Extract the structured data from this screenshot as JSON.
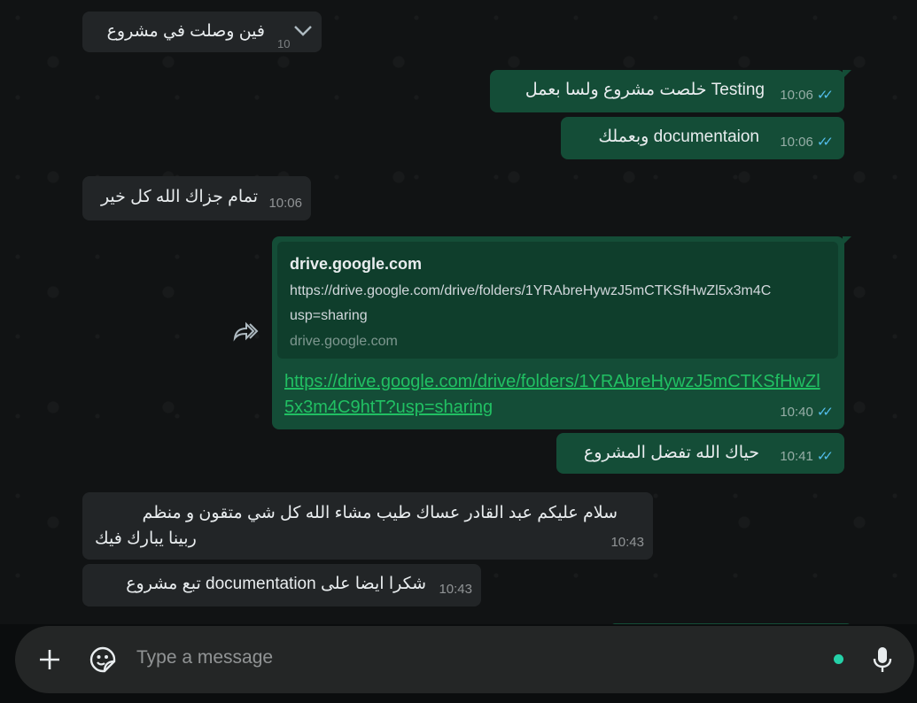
{
  "messages": {
    "m0": {
      "text": "فين وصلت في مشروع",
      "time": "10"
    },
    "m1": {
      "text": "Testing خلصت مشروع ولسا بعمل",
      "time": "10:06"
    },
    "m2": {
      "text": "documentaion وبعملك",
      "time": "10:06"
    },
    "m3": {
      "text": "تمام جزاك الله كل خير",
      "time": "10:06"
    },
    "m4": {
      "card_title": "drive.google.com",
      "card_desc": "https://drive.google.com/drive/folders/1YRAbreHywzJ5mCTKSfHwZl5x3m4C\nusp=sharing",
      "card_domain": "drive.google.com",
      "link": "https://drive.google.com/drive/folders/1YRAbreHywzJ5mCTKSfHwZl5x3m4C9htT?usp=sharing",
      "time": "10:40"
    },
    "m5": {
      "text": "حياك الله تفضل المشروع",
      "time": "10:41"
    },
    "m6": {
      "line1": "سلام عليكم عبد القادر عساك طيب  مشاء الله  كل شي متقون و منظم",
      "line2": "ربينا يبارك فيك",
      "time": "10:43"
    },
    "m7": {
      "text": "شكرا ايضا على documentation تبع مشروع",
      "time": "10:43"
    }
  },
  "ticks": "✓✓",
  "composer": {
    "placeholder": "Type a message"
  },
  "icons": {
    "forward": "forward-icon",
    "chevron": "chevron-down-icon",
    "add": "plus-icon",
    "sticker": "sticker-icon",
    "mic": "mic-icon"
  },
  "colors": {
    "outgoing": "#144d37",
    "incoming": "#222527",
    "link": "#21c063",
    "read_ticks": "#53bdeb",
    "accent": "#25d1a8"
  }
}
